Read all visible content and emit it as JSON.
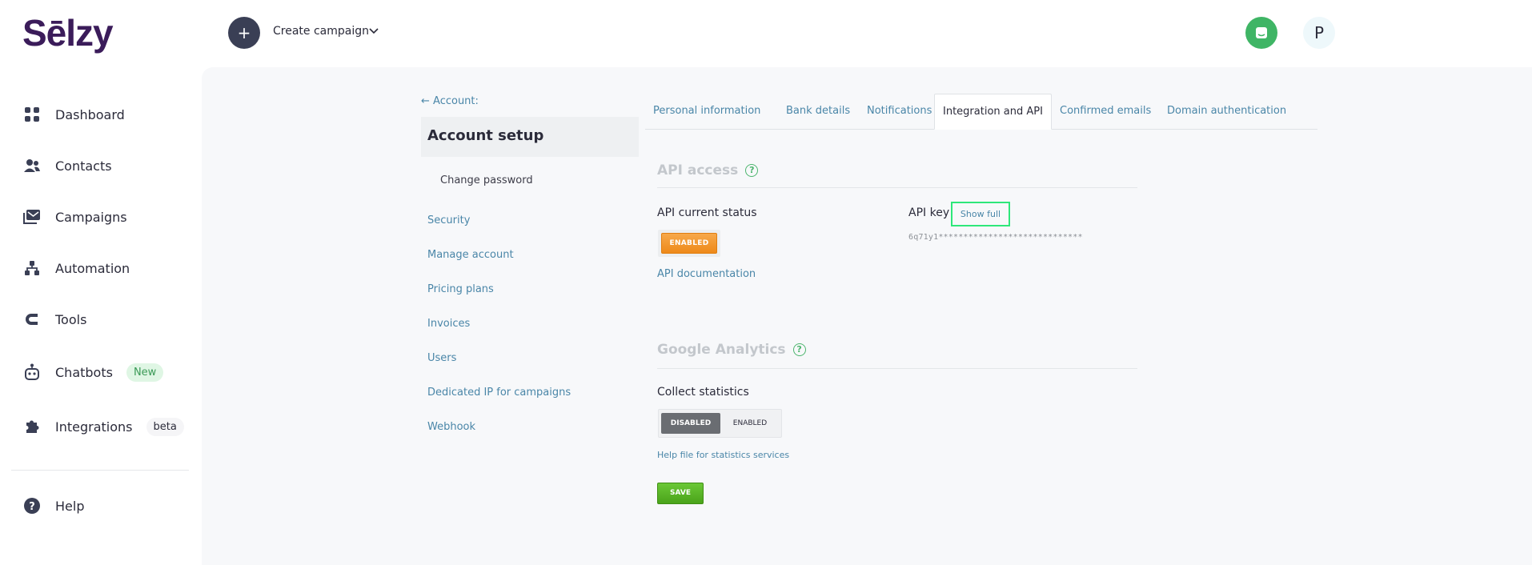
{
  "header": {
    "logo_text": "Sēlzy",
    "create_campaign_label": "Create campaign",
    "create_plus": "+",
    "avatar_letter": "P"
  },
  "sidebar": {
    "items": [
      {
        "label": "Dashboard",
        "icon": "grid-icon"
      },
      {
        "label": "Contacts",
        "icon": "users-icon"
      },
      {
        "label": "Campaigns",
        "icon": "mail-icon"
      },
      {
        "label": "Automation",
        "icon": "flow-icon"
      },
      {
        "label": "Tools",
        "icon": "magnet-icon"
      },
      {
        "label": "Chatbots",
        "icon": "robot-icon",
        "badge": "New"
      },
      {
        "label": "Integrations",
        "icon": "puzzle-icon",
        "badge": "beta"
      },
      {
        "label": "Help",
        "icon": "help-icon"
      }
    ]
  },
  "account": {
    "back_label": "← Account:",
    "title": "Account setup",
    "change_password": "Change password",
    "links": [
      "Security",
      "Manage account",
      "Pricing plans",
      "Invoices",
      "Users",
      "Dedicated IP for campaigns",
      "Webhook"
    ]
  },
  "tabs": [
    "Personal information",
    "Bank details",
    "Notifications",
    "Integration and API",
    "Confirmed emails",
    "Domain authentication"
  ],
  "api": {
    "section_title": "API access",
    "status_label": "API current status",
    "status_button": "ENABLED",
    "documentation_link": "API documentation",
    "key_label": "API key",
    "show_full": "Show full",
    "key_value": "6q71y1*****************************"
  },
  "analytics": {
    "section_title": "Google Analytics",
    "collect_label": "Collect statistics",
    "disabled_label": "DISABLED",
    "enabled_label": "ENABLED",
    "help_link": "Help file for statistics services",
    "save_label": "SAVE"
  },
  "help_glyph": "?",
  "colors": {
    "brand": "#3b1c5a",
    "accent_green": "#27d86b",
    "link": "#4a86a8",
    "enabled_orange": "#ee8a1a",
    "save_green": "#4aa31a"
  }
}
